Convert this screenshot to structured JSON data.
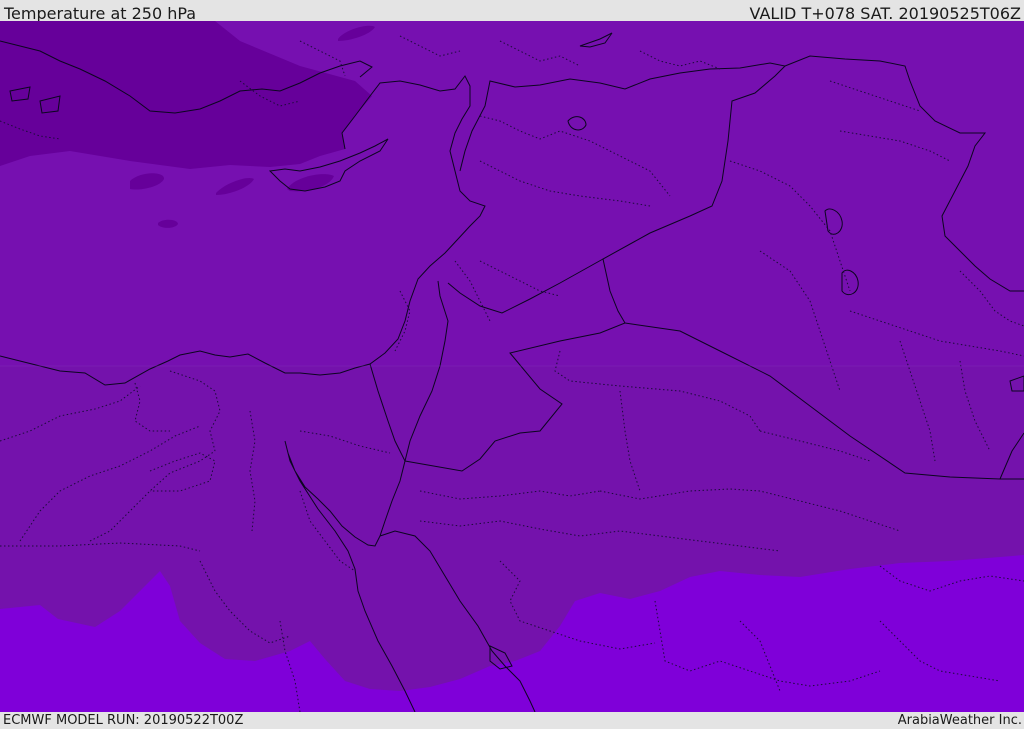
{
  "header": {
    "title": "Temperature at 250 hPa",
    "valid": "VALID T+078 SAT. 20190525T06Z"
  },
  "footer": {
    "model_run": "ECMWF MODEL RUN: 20190522T00Z",
    "credit": "ArabiaWeather Inc."
  },
  "colors": {
    "cold_band": "#66009a",
    "mid_band": "#7610b0",
    "mid_band_land": "#7412ac",
    "warm_band": "#7f00d9",
    "boundary_line": "#0c0520",
    "background": "#e4e4e4"
  }
}
